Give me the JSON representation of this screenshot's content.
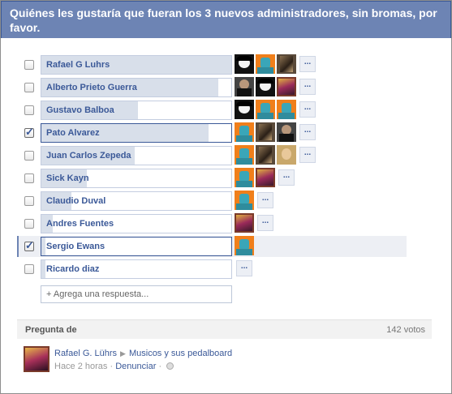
{
  "dialog": {
    "title": "Quiénes les gustaría que fueran los 3 nuevos administradores, sin bromas, por favor."
  },
  "options": [
    {
      "label": "Rafael G Luhrs",
      "checked": false,
      "fill_percent": 100,
      "voters": [
        "a1",
        "a2",
        "a3"
      ],
      "more": "..."
    },
    {
      "label": "Alberto Prieto Guerra",
      "checked": false,
      "fill_percent": 93,
      "voters": [
        "a4",
        "a1",
        "a6"
      ],
      "more": "..."
    },
    {
      "label": "Gustavo Balboa",
      "checked": false,
      "fill_percent": 51,
      "voters": [
        "a1",
        "a2",
        "a2"
      ],
      "more": "..."
    },
    {
      "label": "Pato Alvarez",
      "checked": true,
      "fill_percent": 88,
      "voters": [
        "a2",
        "a3",
        "a4"
      ],
      "more": "..."
    },
    {
      "label": "Juan Carlos Zepeda",
      "checked": false,
      "fill_percent": 49,
      "voters": [
        "a2",
        "a3",
        "a5"
      ],
      "more": "..."
    },
    {
      "label": "Sick Kayn",
      "checked": false,
      "fill_percent": 24,
      "voters": [
        "a2",
        "a6"
      ],
      "more": "..."
    },
    {
      "label": "Claudio Duval",
      "checked": false,
      "fill_percent": 16,
      "voters": [
        "a2"
      ],
      "more": "..."
    },
    {
      "label": "Andres Fuentes",
      "checked": false,
      "fill_percent": 6,
      "voters": [
        "a6"
      ],
      "more": "..."
    },
    {
      "label": "Sergio Ewans",
      "checked": true,
      "fill_percent": 2,
      "voters": [
        "a2"
      ],
      "more": ""
    },
    {
      "label": "Ricardo diaz",
      "checked": false,
      "fill_percent": 2,
      "voters": [],
      "more": "..."
    }
  ],
  "add_answer": {
    "placeholder": "+ Agrega una respuesta..."
  },
  "footer": {
    "pregunta_label": "Pregunta de",
    "votes": "142 votos"
  },
  "author": {
    "name": "Rafael G. Lührs",
    "group": "Musicos y sus pedalboard",
    "time": "Hace 2 horas",
    "separator": "·",
    "report": "Denunciar",
    "separator2": "·"
  },
  "colors": {
    "title_bg": "#6d84b4",
    "link": "#3b5998",
    "bar_fill": "#d8dfea"
  }
}
